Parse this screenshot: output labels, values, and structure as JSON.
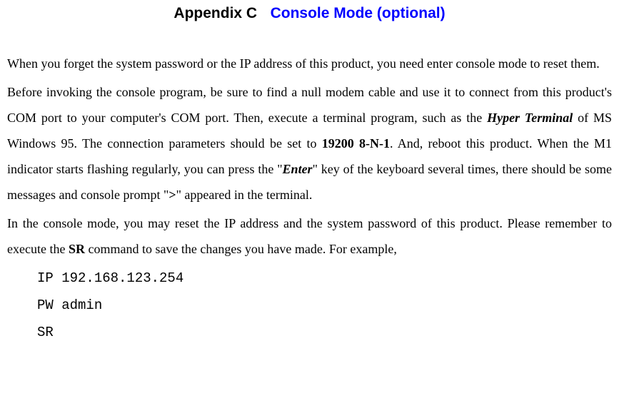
{
  "heading": {
    "appendix": "Appendix C",
    "title": "Console Mode (optional)"
  },
  "para1": {
    "text": "When you forget the system password or the IP address of this product, you need enter console mode to reset them."
  },
  "para2": {
    "t1": "Before invoking the console program, be sure to find a null modem cable and use it to connect from this product's COM port to your computer's COM port. Then, execute a terminal program, such as the ",
    "hyper": "Hyper Terminal",
    "t2": " of MS Windows 95. The connection parameters should be set to ",
    "baud": "19200 8-N-1",
    "t3": ". And, reboot this product. When the M1 indicator starts flashing regularly, you can press the \"",
    "enter": "Enter",
    "t4": "\" key of the keyboard several times, there should be some messages and console prompt \"",
    "prompt": ">",
    "t5": "\" appeared in the terminal."
  },
  "para3": {
    "t1": "In the console mode, you may reset the IP address and the system password of this product. Please remember to execute the ",
    "sr": "SR",
    "t2": " command to save the changes you have made. For example,"
  },
  "code": {
    "line1": "IP 192.168.123.254",
    "line2": "PW admin",
    "line3": "SR"
  }
}
